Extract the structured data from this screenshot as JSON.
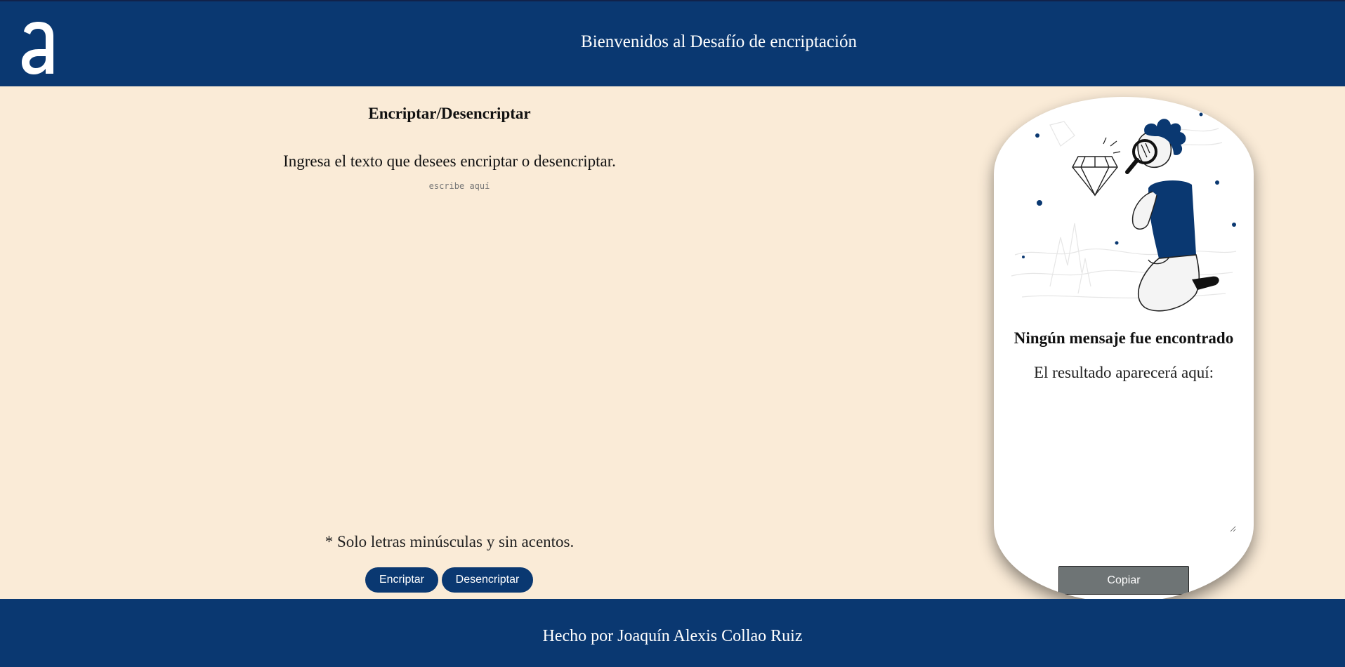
{
  "header": {
    "logo_letter": "a",
    "title": "Bienvenidos al Desafío de encriptación"
  },
  "main": {
    "section_title": "Encriptar/Desencriptar",
    "instruction": "Ingresa el texto que desees encriptar o desencriptar.",
    "input": {
      "placeholder": "escribe aquí",
      "value": ""
    },
    "note": "* Solo letras minúsculas y sin acentos.",
    "buttons": {
      "encrypt_label": "Encriptar",
      "decrypt_label": "Desencriptar"
    }
  },
  "result_panel": {
    "title": "Ningún mensaje fue encontrado",
    "subtitle": "El resultado aparecerá aquí:",
    "output": {
      "value": ""
    },
    "copy_label": "Copiar"
  },
  "footer": {
    "text": "Hecho por Joaquín Alexis Collao Ruiz"
  },
  "colors": {
    "primary": "#0a3871",
    "background": "#faebd7",
    "panel": "#ffffff",
    "copy_button": "#6e7475"
  },
  "icons": {
    "logo": "alura-a-logo",
    "illustration": "person-with-magnifier-illustration"
  }
}
